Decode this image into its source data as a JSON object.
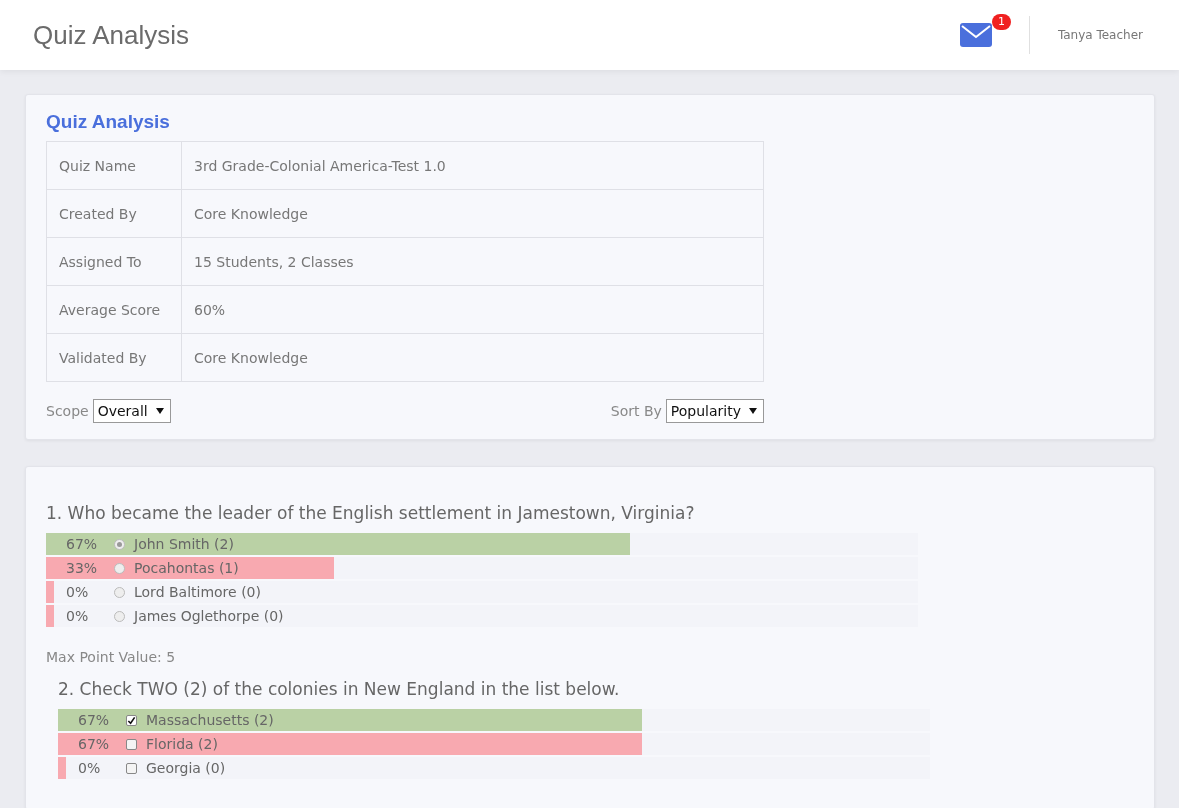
{
  "header": {
    "title": "Quiz Analysis",
    "mail_badge": "1",
    "user_name": "Tanya Teacher"
  },
  "summary": {
    "title": "Quiz Analysis",
    "rows": [
      {
        "label": "Quiz Name",
        "value": "3rd Grade-Colonial America-Test 1.0"
      },
      {
        "label": "Created By",
        "value": "Core Knowledge"
      },
      {
        "label": "Assigned To",
        "value": "15 Students, 2 Classes"
      },
      {
        "label": "Average Score",
        "value": "60%"
      },
      {
        "label": "Validated By",
        "value": "Core Knowledge"
      }
    ],
    "scope": {
      "label": "Scope",
      "value": "Overall"
    },
    "sort": {
      "label": "Sort By",
      "value": "Popularity"
    }
  },
  "questions": [
    {
      "text": "1. Who became the leader of the English settlement in Jamestown, Virginia?",
      "kind": "radio",
      "indented": false,
      "options": [
        {
          "percent": "67%",
          "label": "John Smith (2)",
          "level": 0.67,
          "correct": true,
          "selected": true
        },
        {
          "percent": "33%",
          "label": "Pocahontas (1)",
          "level": 0.33,
          "correct": false,
          "selected": false
        },
        {
          "percent": "0%",
          "label": "Lord Baltimore (0)",
          "level": 0,
          "correct": false,
          "selected": false
        },
        {
          "percent": "0%",
          "label": "James Oglethorpe (0)",
          "level": 0,
          "correct": false,
          "selected": false
        }
      ],
      "max_points": "Max Point Value: 5"
    },
    {
      "text": "2. Check TWO (2) of the colonies in New England in the list below.",
      "kind": "checkbox",
      "indented": true,
      "options": [
        {
          "percent": "67%",
          "label": "Massachusetts (2)",
          "level": 0.67,
          "correct": true,
          "selected": true
        },
        {
          "percent": "67%",
          "label": "Florida (2)",
          "level": 0.67,
          "correct": false,
          "selected": false
        },
        {
          "percent": "0%",
          "label": "Georgia (0)",
          "level": 0,
          "correct": false,
          "selected": false
        }
      ]
    }
  ]
}
